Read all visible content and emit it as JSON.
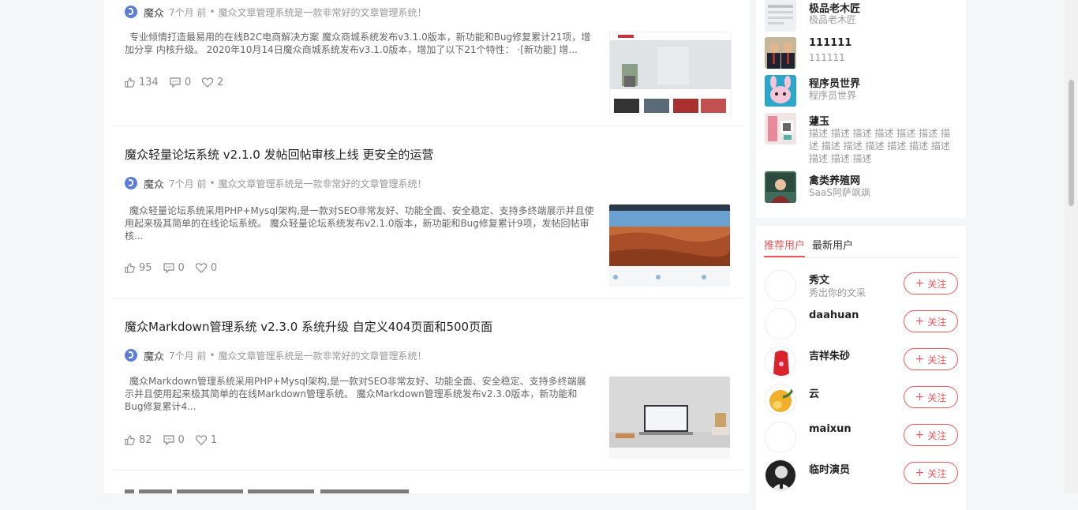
{
  "articles": [
    {
      "title": "",
      "author": "魔众",
      "time": "7个月 前",
      "dot": "•",
      "category": "魔众文章管理系统是一款非常好的文章管理系统！",
      "excerpt": "专业倾情打造最易用的在线B2C电商解决方案 魔众商城系统发布v3.1.0版本，新功能和Bug修复累计21项，增加分享 内核升级。  2020年10月14日魔众商城系统发布v3.1.0版本，增加了以下21个特性： ·[新功能] 增...",
      "likes": "134",
      "comments": "0",
      "favorites": "2"
    },
    {
      "title": "魔众轻量论坛系统 v2.1.0 发帖回帖审核上线 更安全的运营",
      "author": "魔众",
      "time": "7个月 前",
      "dot": "•",
      "category": "魔众文章管理系统是一款非常好的文章管理系统！",
      "excerpt": "魔众轻量论坛系统采用PHP+Mysql架构,是一款对SEO非常友好、功能全面、安全稳定、支持多终端展示并且使用起来极其简单的在线论坛系统。 魔众轻量论坛系统发布v2.1.0版本，新功能和Bug修复累计9项，发帖回帖审核...",
      "likes": "95",
      "comments": "0",
      "favorites": "0"
    },
    {
      "title": "魔众Markdown管理系统 v2.3.0 系统升级 自定义404页面和500页面",
      "author": "魔众",
      "time": "7个月 前",
      "dot": "•",
      "category": "魔众文章管理系统是一款非常好的文章管理系统！",
      "excerpt": "魔众Markdown管理系统采用PHP+Mysql架构,是一款对SEO非常友好、功能全面、安全稳定、支持多终端展示并且使用起来极其简单的在线Markdown管理系统。 魔众Markdown管理系统发布v2.3.0版本，新功能和Bug修复累计4...",
      "likes": "82",
      "comments": "0",
      "favorites": "1"
    }
  ],
  "sidebar": {
    "users": [
      {
        "name": "极品老木匠",
        "desc": "极品老木匠"
      },
      {
        "name": "111111",
        "desc": "111111"
      },
      {
        "name": "程序员世界",
        "desc": "程序员世界"
      },
      {
        "name": "蘧玉",
        "desc": "描述 描述 描述 描述 描述 描述 描述 描述 描述 描述 描述 描述 描述 描述 描述 描述"
      },
      {
        "name": "禽类养殖网",
        "desc": "SaaS阿萨飒飒"
      }
    ],
    "tabs": [
      {
        "label": "推荐用户",
        "active": true
      },
      {
        "label": "最新用户",
        "active": false
      }
    ],
    "follow_label": "关注",
    "follow_plus": "+",
    "recommended": [
      {
        "name": "秀文",
        "desc": "秀出你的文采"
      },
      {
        "name": "daahuan",
        "desc": ""
      },
      {
        "name": "吉祥朱砂",
        "desc": ""
      },
      {
        "name": "云",
        "desc": ""
      },
      {
        "name": "maixun",
        "desc": ""
      },
      {
        "name": "临时演员",
        "desc": ""
      }
    ]
  },
  "colors": {
    "accent": "#e8595b",
    "background": "#f5f6f7",
    "author_avatar": "#5b7ed8"
  }
}
